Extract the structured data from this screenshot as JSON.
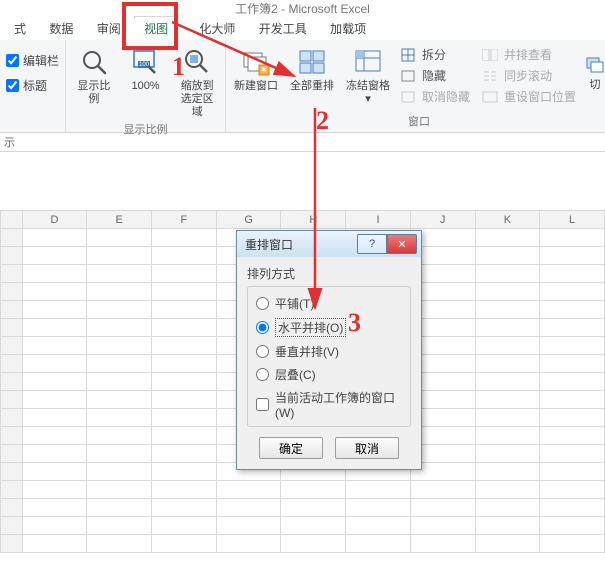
{
  "app_title": "工作簿2 - Microsoft Excel",
  "tabs": {
    "t0": "式",
    "t1": "数据",
    "t2": "审阅",
    "t3": "视图",
    "t4": "化大师",
    "t5": "开发工具",
    "t6": "加载项"
  },
  "status_left": "示",
  "show_group": {
    "chk1": "编辑栏",
    "chk2": "标题"
  },
  "zoom_group": {
    "label": "显示比例",
    "btn1": "显示比例",
    "btn2": "100%",
    "btn3_l1": "缩放到",
    "btn3_l2": "选定区域"
  },
  "window_group": {
    "label": "窗口",
    "new_window": "新建窗口",
    "arrange_all": "全部重排",
    "freeze": "冻结窗格",
    "split": "拆分",
    "hide": "隐藏",
    "unhide": "取消隐藏",
    "side_by_side": "并排查看",
    "sync_scroll": "同步滚动",
    "reset_pos": "重设窗口位置",
    "switch_l1": "切"
  },
  "columns": [
    "D",
    "E",
    "F",
    "G",
    "H",
    "I",
    "J",
    "K",
    "L"
  ],
  "dialog": {
    "title": "重排窗口",
    "section": "排列方式",
    "opt_tile": "平铺(T)",
    "opt_horizontal": "水平并排(O)",
    "opt_vertical": "垂直并排(V)",
    "opt_cascade": "层叠(C)",
    "chk_active": "当前活动工作簿的窗口(W)",
    "ok": "确定",
    "cancel": "取消",
    "help": "?",
    "close": "✕"
  },
  "anno": {
    "n1": "1",
    "n2": "2",
    "n3": "3"
  }
}
